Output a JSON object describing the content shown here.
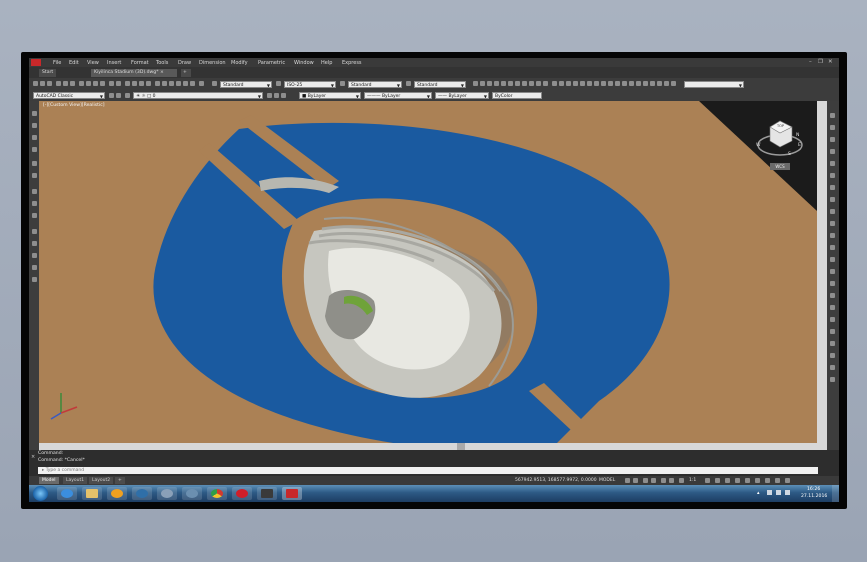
{
  "window": {
    "title": "Autodesk AutoCAD 2016"
  },
  "menu": [
    "File",
    "Edit",
    "View",
    "Insert",
    "Format",
    "Tools",
    "Draw",
    "Dimension",
    "Modify",
    "Parametric",
    "Window",
    "Help",
    "Express"
  ],
  "tabs": [
    {
      "label": "Start"
    },
    {
      "label": "Kiyilinca Stadium (3D).dwg*"
    }
  ],
  "workspace": "AutoCAD Classic",
  "styles": {
    "text": "Standard",
    "dim": "ISO-25",
    "table": "Standard",
    "mleader": "Standard"
  },
  "properties": {
    "layer_state": "0",
    "color": "ByLayer",
    "linetype": "ByLayer",
    "lineweight": "ByLayer",
    "plotstyle": "ByColor"
  },
  "viewport": {
    "label": "[-][Custom View][Realistic]",
    "viewcube": {
      "top": "TOP",
      "north": "N",
      "east": "E",
      "south": "S",
      "west": "W",
      "wcs": "WCS"
    }
  },
  "command": {
    "lines": [
      "Command:",
      "Command: *Cancel*"
    ],
    "placeholder": "Type a command"
  },
  "layout_tabs": [
    "Model",
    "Layout1",
    "Layout2"
  ],
  "status": {
    "coords": "567942.9513, 168577.9972, 0.0000",
    "mode": "MODEL",
    "scale": "1:1"
  },
  "clock": {
    "time": "16:26",
    "date": "27.11.2016"
  },
  "colors": {
    "ground": "#ab8155",
    "water": "#1a5aa0",
    "shell": "#c6c6bf",
    "seats": "#6fa33a"
  }
}
